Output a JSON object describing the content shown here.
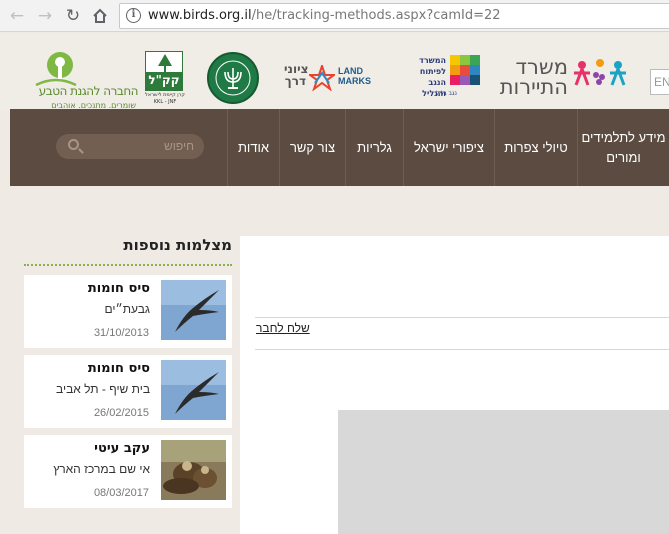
{
  "browser": {
    "url_host": "www.birds.org.il",
    "url_path": "/he/tracking-methods.aspx?camId=22"
  },
  "header": {
    "logos": {
      "spnb_name": "החברה להגנת הטבע",
      "spnb_tagline": "שומרים. מתנכים. אוהבים",
      "kkl_name": "קק\"ל",
      "kkl_sub": "קרן קיימת לישראל",
      "kkl_latin": "KKL - JNF",
      "tziyunei_derech": "ציוני דרך",
      "landmarks": "LAND MARKS",
      "negev_galil_line1": "המשרד",
      "negev_galil_line2": "לפיתוח",
      "negev_galil_line3": "הנגב והגליל",
      "negev_galil_sub": "נגב גליל",
      "tourism_line1": "משרד",
      "tourism_line2": "התיירות"
    },
    "lang_label": "EN"
  },
  "nav": {
    "items": [
      "מידע לתלמידים ומורים",
      "טיולי צפרות",
      "ציפורי ישראל",
      "גלריות",
      "צור קשר",
      "אודות"
    ],
    "search_placeholder": "חיפוש"
  },
  "main": {
    "send_to_friend": "שלח לחבר"
  },
  "sidebar": {
    "title": "מצלמות נוספות",
    "cards": [
      {
        "title": "סיס חומות",
        "place": "גבעת״ים",
        "date": "31/10/2013"
      },
      {
        "title": "סיס חומות",
        "place": "בית שיף - תל אביב",
        "date": "26/02/2015"
      },
      {
        "title": "עקב עיטי",
        "place": "אי שם במרכז הארץ",
        "date": "08/03/2017"
      }
    ]
  },
  "colors": {
    "nav_bg": "#5b4b40",
    "accent_green": "#8ab24c"
  }
}
